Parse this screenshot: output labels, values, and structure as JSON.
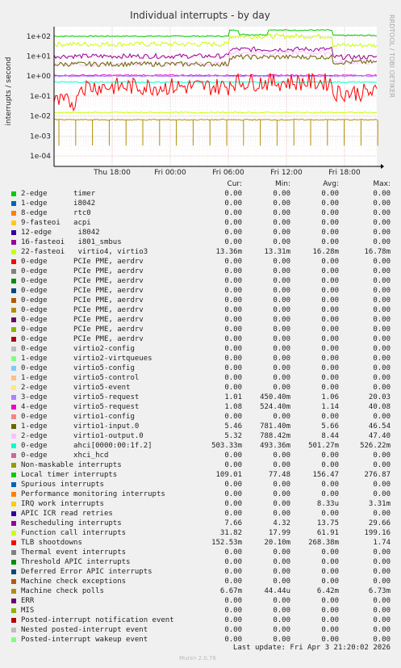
{
  "graph": {
    "title": "Individual interrupts - by day",
    "ylabel": "interrupts / second",
    "side_label": "RRDTOOL / TOBI OETIKER",
    "y_ticks": [
      "1e+02",
      "1e+01",
      "1e+00",
      "1e-01",
      "1e-02",
      "1e-03",
      "1e-04"
    ],
    "x_ticks": [
      "Thu 18:00",
      "Fri 00:00",
      "Fri 06:00",
      "Fri 12:00",
      "Fri 18:00"
    ]
  },
  "legend": {
    "headers": {
      "cur": "Cur:",
      "min": "Min:",
      "avg": "Avg:",
      "max": "Max:"
    },
    "rows": [
      {
        "label": "2-edge      timer",
        "color": "#00cc00",
        "cur": "0.00",
        "min": "0.00",
        "avg": "0.00",
        "max": "0.00"
      },
      {
        "label": "1-edge      i8042",
        "color": "#0066b3",
        "cur": "0.00",
        "min": "0.00",
        "avg": "0.00",
        "max": "0.00"
      },
      {
        "label": "8-edge      rtc0",
        "color": "#ff8000",
        "cur": "0.00",
        "min": "0.00",
        "avg": "0.00",
        "max": "0.00"
      },
      {
        "label": "9-fasteoi   acpi",
        "color": "#ffcc00",
        "cur": "0.00",
        "min": "0.00",
        "avg": "0.00",
        "max": "0.00"
      },
      {
        "label": "12-edge      i8042",
        "color": "#330099",
        "cur": "0.00",
        "min": "0.00",
        "avg": "0.00",
        "max": "0.00"
      },
      {
        "label": "16-fasteoi   i801_smbus",
        "color": "#990099",
        "cur": "0.00",
        "min": "0.00",
        "avg": "0.00",
        "max": "0.00"
      },
      {
        "label": "22-fasteoi   virtio4, virtio3",
        "color": "#ccff00",
        "cur": "13.36m",
        "min": "13.31m",
        "avg": "16.28m",
        "max": "16.78m"
      },
      {
        "label": "0-edge      PCIe PME, aerdrv",
        "color": "#ff0000",
        "cur": "0.00",
        "min": "0.00",
        "avg": "0.00",
        "max": "0.00"
      },
      {
        "label": "0-edge      PCIe PME, aerdrv",
        "color": "#808080",
        "cur": "0.00",
        "min": "0.00",
        "avg": "0.00",
        "max": "0.00"
      },
      {
        "label": "0-edge      PCIe PME, aerdrv",
        "color": "#008f00",
        "cur": "0.00",
        "min": "0.00",
        "avg": "0.00",
        "max": "0.00"
      },
      {
        "label": "0-edge      PCIe PME, aerdrv",
        "color": "#00487d",
        "cur": "0.00",
        "min": "0.00",
        "avg": "0.00",
        "max": "0.00"
      },
      {
        "label": "0-edge      PCIe PME, aerdrv",
        "color": "#b35a00",
        "cur": "0.00",
        "min": "0.00",
        "avg": "0.00",
        "max": "0.00"
      },
      {
        "label": "0-edge      PCIe PME, aerdrv",
        "color": "#b38f00",
        "cur": "0.00",
        "min": "0.00",
        "avg": "0.00",
        "max": "0.00"
      },
      {
        "label": "0-edge      PCIe PME, aerdrv",
        "color": "#6b006b",
        "cur": "0.00",
        "min": "0.00",
        "avg": "0.00",
        "max": "0.00"
      },
      {
        "label": "0-edge      PCIe PME, aerdrv",
        "color": "#8fb300",
        "cur": "0.00",
        "min": "0.00",
        "avg": "0.00",
        "max": "0.00"
      },
      {
        "label": "0-edge      PCIe PME, aerdrv",
        "color": "#b30000",
        "cur": "0.00",
        "min": "0.00",
        "avg": "0.00",
        "max": "0.00"
      },
      {
        "label": "0-edge      virtio2-config",
        "color": "#bebebe",
        "cur": "0.00",
        "min": "0.00",
        "avg": "0.00",
        "max": "0.00"
      },
      {
        "label": "1-edge      virtio2-virtqueues",
        "color": "#80ff80",
        "cur": "0.00",
        "min": "0.00",
        "avg": "0.00",
        "max": "0.00"
      },
      {
        "label": "0-edge      virtio5-config",
        "color": "#80c9ff",
        "cur": "0.00",
        "min": "0.00",
        "avg": "0.00",
        "max": "0.00"
      },
      {
        "label": "1-edge      virtio5-control",
        "color": "#ffc080",
        "cur": "0.00",
        "min": "0.00",
        "avg": "0.00",
        "max": "0.00"
      },
      {
        "label": "2-edge      virtio5-event",
        "color": "#ffe680",
        "cur": "0.00",
        "min": "0.00",
        "avg": "0.00",
        "max": "0.00"
      },
      {
        "label": "3-edge      virtio5-request",
        "color": "#aa80ff",
        "cur": "1.01",
        "min": "450.40m",
        "avg": "1.06",
        "max": "20.03"
      },
      {
        "label": "4-edge      virtio5-request",
        "color": "#ee00cc",
        "cur": "1.08",
        "min": "524.40m",
        "avg": "1.14",
        "max": "40.08"
      },
      {
        "label": "0-edge      virtio1-config",
        "color": "#ff8080",
        "cur": "0.00",
        "min": "0.00",
        "avg": "0.00",
        "max": "0.00"
      },
      {
        "label": "1-edge      virtio1-input.0",
        "color": "#666600",
        "cur": "5.46",
        "min": "781.40m",
        "avg": "5.66",
        "max": "46.54"
      },
      {
        "label": "2-edge      virtio1-output.0",
        "color": "#ffbfff",
        "cur": "5.32",
        "min": "788.42m",
        "avg": "8.44",
        "max": "47.40"
      },
      {
        "label": "0-edge      ahci[0000:00:1f.2]",
        "color": "#00ffcc",
        "cur": "503.33m",
        "min": "493.36m",
        "avg": "501.27m",
        "max": "526.22m"
      },
      {
        "label": "0-edge      xhci_hcd",
        "color": "#cc6699",
        "cur": "0.00",
        "min": "0.00",
        "avg": "0.00",
        "max": "0.00"
      },
      {
        "label": "Non-maskable interrupts",
        "color": "#999900",
        "cur": "0.00",
        "min": "0.00",
        "avg": "0.00",
        "max": "0.00"
      },
      {
        "label": "Local timer interrupts",
        "color": "#00cc00",
        "cur": "109.01",
        "min": "77.48",
        "avg": "156.47",
        "max": "276.87"
      },
      {
        "label": "Spurious interrupts",
        "color": "#0066b3",
        "cur": "0.00",
        "min": "0.00",
        "avg": "0.00",
        "max": "0.00"
      },
      {
        "label": "Performance monitoring interrupts",
        "color": "#ff8000",
        "cur": "0.00",
        "min": "0.00",
        "avg": "0.00",
        "max": "0.00"
      },
      {
        "label": "IRQ work interrupts",
        "color": "#ffcc00",
        "cur": "0.00",
        "min": "0.00",
        "avg": "8.33u",
        "max": "3.31m"
      },
      {
        "label": "APIC ICR read retries",
        "color": "#330099",
        "cur": "0.00",
        "min": "0.00",
        "avg": "0.00",
        "max": "0.00"
      },
      {
        "label": "Rescheduling interrupts",
        "color": "#990099",
        "cur": "7.66",
        "min": "4.32",
        "avg": "13.75",
        "max": "29.66"
      },
      {
        "label": "Function call interrupts",
        "color": "#ccff00",
        "cur": "31.82",
        "min": "17.99",
        "avg": "61.91",
        "max": "199.16"
      },
      {
        "label": "TLB shootdowns",
        "color": "#ff0000",
        "cur": "152.53m",
        "min": "20.10m",
        "avg": "268.38m",
        "max": "1.74"
      },
      {
        "label": "Thermal event interrupts",
        "color": "#808080",
        "cur": "0.00",
        "min": "0.00",
        "avg": "0.00",
        "max": "0.00"
      },
      {
        "label": "Threshold APIC interrupts",
        "color": "#008f00",
        "cur": "0.00",
        "min": "0.00",
        "avg": "0.00",
        "max": "0.00"
      },
      {
        "label": "Deferred Error APIC interrupts",
        "color": "#00487d",
        "cur": "0.00",
        "min": "0.00",
        "avg": "0.00",
        "max": "0.00"
      },
      {
        "label": "Machine check exceptions",
        "color": "#b35a00",
        "cur": "0.00",
        "min": "0.00",
        "avg": "0.00",
        "max": "0.00"
      },
      {
        "label": "Machine check polls",
        "color": "#b38f00",
        "cur": "6.67m",
        "min": "44.44u",
        "avg": "6.42m",
        "max": "6.73m"
      },
      {
        "label": "ERR",
        "color": "#6b006b",
        "cur": "0.00",
        "min": "0.00",
        "avg": "0.00",
        "max": "0.00"
      },
      {
        "label": "MIS",
        "color": "#8fb300",
        "cur": "0.00",
        "min": "0.00",
        "avg": "0.00",
        "max": "0.00"
      },
      {
        "label": "Posted-interrupt notification event",
        "color": "#b30000",
        "cur": "0.00",
        "min": "0.00",
        "avg": "0.00",
        "max": "0.00"
      },
      {
        "label": "Nested posted-interrupt event",
        "color": "#bebebe",
        "cur": "0.00",
        "min": "0.00",
        "avg": "0.00",
        "max": "0.00"
      },
      {
        "label": "Posted-interrupt wakeup event",
        "color": "#80ff80",
        "cur": "0.00",
        "min": "0.00",
        "avg": "0.00",
        "max": "0.00"
      }
    ]
  },
  "footer": {
    "last_update": "Last update: Fri Apr  3 21:20:02 2026",
    "version": "Munin 2.0.76"
  },
  "chart_data": {
    "type": "line",
    "title": "Individual interrupts - by day",
    "ylabel": "interrupts / second",
    "yscale": "log",
    "ylim": [
      3e-05,
      300
    ],
    "x_ticks": [
      "Thu 18:00",
      "Fri 00:00",
      "Fri 06:00",
      "Fri 12:00",
      "Fri 18:00"
    ],
    "grid": true,
    "series": [
      {
        "name": "Local timer interrupts",
        "color": "#00cc00",
        "segments": [
          {
            "from": 0,
            "to": 0.54,
            "value": 100
          },
          {
            "from": 0.54,
            "to": 0.57,
            "value": 200
          },
          {
            "from": 0.57,
            "to": 0.66,
            "value": 120
          },
          {
            "from": 0.66,
            "to": 0.69,
            "value": 210
          },
          {
            "from": 0.69,
            "to": 0.86,
            "value": 200
          },
          {
            "from": 0.86,
            "to": 1,
            "value": 110
          }
        ]
      },
      {
        "name": "Function call interrupts",
        "color": "#ccff00",
        "segments": [
          {
            "from": 0,
            "to": 0.54,
            "value": 40
          },
          {
            "from": 0.54,
            "to": 0.86,
            "value": 100
          },
          {
            "from": 0.86,
            "to": 1,
            "value": 35
          }
        ]
      },
      {
        "name": "Rescheduling interrupts",
        "color": "#990099",
        "segments": [
          {
            "from": 0,
            "to": 0.54,
            "value": 10
          },
          {
            "from": 0.54,
            "to": 0.86,
            "value": 22
          },
          {
            "from": 0.86,
            "to": 1,
            "value": 9
          }
        ]
      },
      {
        "name": "virtio1-output.0",
        "color": "#ffbfff",
        "segments": [
          {
            "from": 0,
            "to": 0.54,
            "value": 4
          },
          {
            "from": 0.54,
            "to": 0.86,
            "value": 15
          },
          {
            "from": 0.86,
            "to": 1,
            "value": 5
          }
        ]
      },
      {
        "name": "virtio1-input.0",
        "color": "#666600",
        "segments": [
          {
            "from": 0,
            "to": 0.54,
            "value": 4
          },
          {
            "from": 0.54,
            "to": 0.86,
            "value": 9
          },
          {
            "from": 0.86,
            "to": 1,
            "value": 5
          }
        ]
      },
      {
        "name": "virtio5-request",
        "color": "#ee00cc",
        "segments": [
          {
            "from": 0,
            "to": 1,
            "value": 1.1
          }
        ]
      },
      {
        "name": "virtio5-request",
        "color": "#aa80ff",
        "segments": [
          {
            "from": 0,
            "to": 1,
            "value": 1.0
          }
        ]
      },
      {
        "name": "ahci[0000:00:1f.2]",
        "color": "#00ffcc",
        "segments": [
          {
            "from": 0,
            "to": 1,
            "value": 0.5
          }
        ]
      },
      {
        "name": "TLB shootdowns",
        "color": "#ff0000",
        "segments": [
          {
            "from": 0,
            "to": 0.07,
            "value": 0.05
          },
          {
            "from": 0.07,
            "to": 0.54,
            "value": 0.3
          },
          {
            "from": 0.54,
            "to": 0.86,
            "value": 0.5
          },
          {
            "from": 0.86,
            "to": 1,
            "value": 0.15
          }
        ]
      },
      {
        "name": "22-fasteoi   virtio4, virtio3",
        "color": "#ccff00",
        "segments": [
          {
            "from": 0,
            "to": 1,
            "value": 0.015
          }
        ]
      },
      {
        "name": "Machine check polls",
        "color": "#b38f00",
        "segments": [
          {
            "from": 0,
            "to": 1,
            "value": 0.0065
          }
        ]
      }
    ]
  }
}
